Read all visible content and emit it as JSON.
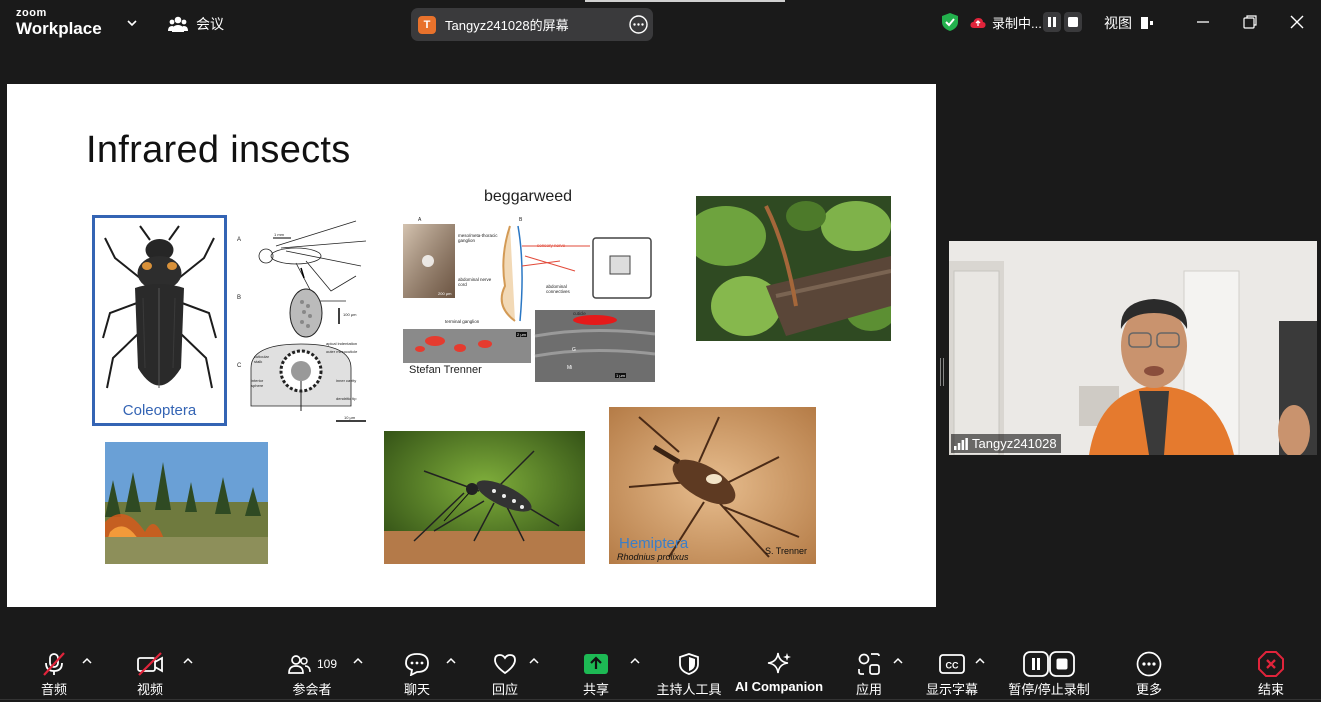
{
  "topbar": {
    "brand_small": "zoom",
    "brand_large": "Workplace",
    "meeting_label": "会议",
    "share_avatar_letter": "T",
    "share_title": "Tangyz241028的屏幕",
    "recording_label": "录制中...",
    "view_label": "视图"
  },
  "slide": {
    "title": "Infrared insects",
    "beggarweed_label": "beggarweed",
    "coleoptera_label": "Coleoptera",
    "fig_label_a": "A",
    "fig_label_b": "B",
    "fig_label_c": "C",
    "scale_1mm": "1 mm",
    "scale_100um": "100 μm",
    "scale_10um": "10 μm",
    "anat_apical": "apical indentation",
    "anat_outer": "outer mesocuticle",
    "anat_cuticular": "cuticular stalk",
    "anat_interior": "interior sphere",
    "anat_inner": "inner cavity",
    "anat_dendritic": "dendritic tip",
    "neuro_meso": "meso/meta-thoracic ganglion",
    "neuro_sensory": "sensory nerve",
    "neuro_abd_cord": "abdominal nerve cord",
    "neuro_abd_conn": "abdominal connectives",
    "neuro_terminal": "terminal ganglion",
    "neuro_cuticle": "cuticle",
    "neuro_200": "200 μm",
    "neuro_2um": "2 μm",
    "neuro_1um": "1 μm",
    "neuro_g": "G",
    "neuro_mi": "Mi",
    "stefan_credit": "Stefan Trenner",
    "hemiptera_label": "Hemiptera",
    "rhodnius_label": "Rhodnius prolixus",
    "s_trenner_credit": "S. Trenner"
  },
  "video": {
    "participant_name": "Tangyz241028"
  },
  "toolbar": {
    "audio_label": "音频",
    "video_label": "视频",
    "participants_label": "参会者",
    "participants_count": "109",
    "chat_label": "聊天",
    "react_label": "回应",
    "share_label": "共享",
    "host_tools_label": "主持人工具",
    "ai_companion_label": "AI Companion",
    "apps_label": "应用",
    "captions_label": "显示字幕",
    "record_label": "暂停/停止录制",
    "more_label": "更多",
    "end_label": "结束"
  },
  "colors": {
    "background": "#1a1a1a",
    "share_green": "#1db954",
    "end_red": "#e0243b",
    "shield_green": "#23b14d",
    "coleoptera_blue": "#3464b4"
  }
}
